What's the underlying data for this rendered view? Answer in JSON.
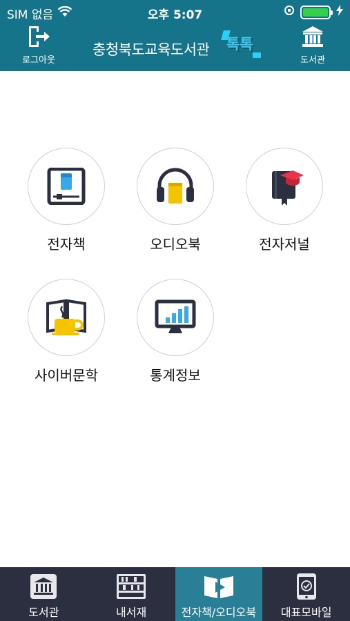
{
  "status_bar": {
    "carrier": "SIM 없음",
    "time": "오후 5:07"
  },
  "header": {
    "logout_label": "로그아웃",
    "title": "충청북도교육도서관",
    "title_accent": "톡톡",
    "library_label": "도서관"
  },
  "menu": {
    "items": [
      {
        "label": "전자책",
        "icon": "ebook-icon"
      },
      {
        "label": "오디오북",
        "icon": "audiobook-icon"
      },
      {
        "label": "전자저널",
        "icon": "ejournal-icon"
      },
      {
        "label": "사이버문학",
        "icon": "cyber-literature-icon"
      },
      {
        "label": "통계정보",
        "icon": "statistics-icon"
      }
    ]
  },
  "tabbar": {
    "tabs": [
      {
        "label": "도서관",
        "icon": "library-icon",
        "active": false
      },
      {
        "label": "내서재",
        "icon": "bookshelf-icon",
        "active": false
      },
      {
        "label": "전자책/오디오북",
        "icon": "ebook-play-icon",
        "active": true
      },
      {
        "label": "대표모바일",
        "icon": "mobile-icon",
        "active": false
      }
    ]
  },
  "colors": {
    "header_bg": "#157489",
    "tabbar_bg": "#2b2f3f",
    "tab_active_bg": "#2a7f96",
    "battery": "#35d04b",
    "accent_yellow": "#f5c400",
    "accent_blue": "#3aa8e8",
    "accent_red": "#e8344a",
    "icon_dark": "#2b2f3f"
  }
}
